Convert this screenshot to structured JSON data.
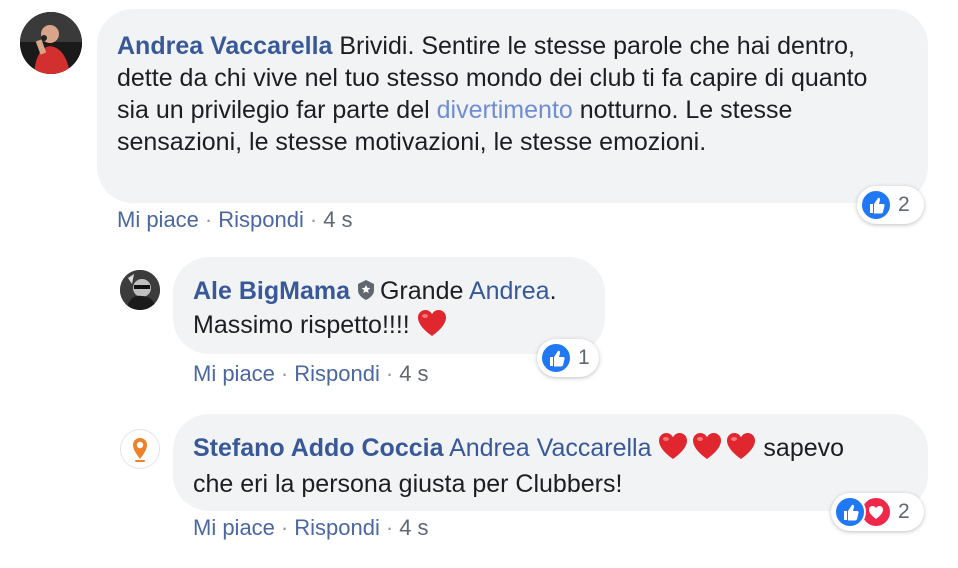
{
  "comments": [
    {
      "author": "Andrea Vaccarella",
      "text_part1": "Brividi. Sentire le stesse parole che hai dentro, dette da chi vive nel tuo stesso mondo dei club ti fa capire di quanto sia un privilegio far parte del ",
      "hashtag": "divertimento",
      "text_part2": " notturno. Le stesse sensazioni, le stesse motivazioni, le stesse emozioni.",
      "like_label": "Mi piace",
      "reply_label": "Rispondi",
      "time": "4 s",
      "reaction_count": "2",
      "reactions": [
        "like-icon"
      ]
    },
    {
      "author": "Ale BigMama",
      "text_part1": "Grande ",
      "mention": "Andrea",
      "text_part2": ".",
      "text_line2": "Massimo rispetto!!!!",
      "like_label": "Mi piace",
      "reply_label": "Rispondi",
      "time": "4 s",
      "reaction_count": "1",
      "reactions": [
        "like-icon"
      ]
    },
    {
      "author": "Stefano Addo Coccia",
      "mention": "Andrea Vaccarella",
      "text_part1": " sapevo",
      "text_line2": "che eri la persona giusta per Clubbers!",
      "like_label": "Mi piace",
      "reply_label": "Rispondi",
      "time": "4 s",
      "reaction_count": "2",
      "reactions": [
        "like-icon",
        "love-icon"
      ]
    }
  ],
  "colors": {
    "link": "#385898",
    "bubble": "#f2f3f5",
    "like_blue": "#2078f4",
    "love_red": "#f0284a"
  }
}
